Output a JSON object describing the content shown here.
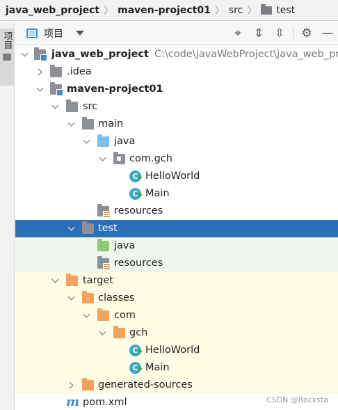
{
  "breadcrumb": {
    "items": [
      "java_web_project",
      "maven-project01",
      "src",
      "test"
    ]
  },
  "left_strip": {
    "tab_label": "项目"
  },
  "toolbar": {
    "view_label": "项目",
    "buttons": [
      "crosshair-icon",
      "expand-all-icon",
      "collapse-all-icon",
      "gear-icon",
      "minimize-icon"
    ]
  },
  "tree": {
    "root": {
      "label": "java_web_project",
      "path": "C:\\code\\javaWebProject\\java_web_pr"
    },
    "idea": ".idea",
    "module": "maven-project01",
    "src": "src",
    "main": "main",
    "main_java": "java",
    "pkg": "com.gch",
    "class_helloworld": "HelloWorld",
    "class_main": "Main",
    "main_resources": "resources",
    "test": "test",
    "test_java": "java",
    "test_resources": "resources",
    "target": "target",
    "classes": "classes",
    "com": "com",
    "gch": "gch",
    "out_helloworld": "HelloWorld",
    "out_main": "Main",
    "generated": "generated-sources",
    "pom": "pom.xml"
  },
  "watermark": "CSDN @Rocksta",
  "colors": {
    "selection": "#2a6fb8",
    "test_bg": "#eef7e8",
    "excluded_bg": "#fdfde6",
    "folder_grey": "#8d9197",
    "folder_blue": "#7cc0ea",
    "folder_green": "#8dca78",
    "folder_orange": "#f2a25c"
  }
}
